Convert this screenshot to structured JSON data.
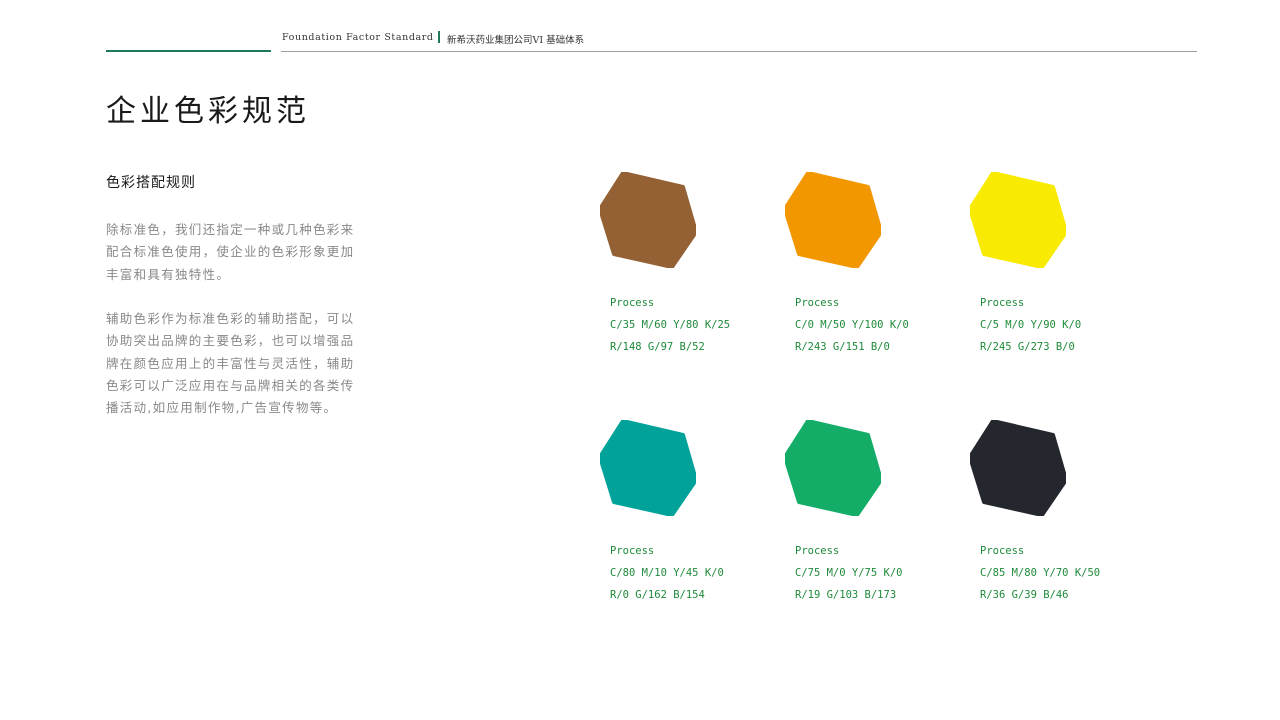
{
  "header": {
    "title_en": "Foundation Factor Standard",
    "title_cn": "新希沃药业集团公司VI 基础体系"
  },
  "page_title": "企业色彩规范",
  "section": {
    "title": "色彩搭配规则",
    "paragraph1": "除标准色，我们还指定一种或几种色彩来配合标准色使用，使企业的色彩形象更加丰富和具有独特性。",
    "paragraph2": "辅助色彩作为标准色彩的辅助搭配，可以协助突出品牌的主要色彩，也可以增强品牌在颜色应用上的丰富性与灵活性，辅助色彩可以广泛应用在与品牌相关的各类传播活动,如应用制作物,广告宣传物等。"
  },
  "swatches": [
    {
      "color": "#946134",
      "label": "Process",
      "cmyk": "C/35 M/60 Y/80 K/25",
      "rgb": "R/148 G/97 B/52"
    },
    {
      "color": "#F39700",
      "label": "Process",
      "cmyk": "C/0 M/50 Y/100 K/0",
      "rgb": "R/243 G/151 B/0"
    },
    {
      "color": "#F8EA00",
      "label": "Process",
      "cmyk": "C/5 M/0 Y/90 K/0",
      "rgb": "R/245 G/273 B/0"
    },
    {
      "color": "#00A29A",
      "label": "Process",
      "cmyk": "C/80 M/10 Y/45 K/0",
      "rgb": "R/0 G/162 B/154"
    },
    {
      "color": "#13AD67",
      "label": "Process",
      "cmyk": "C/75 M/0 Y/75 K/0",
      "rgb": "R/19 G/103 B/173"
    },
    {
      "color": "#24272E",
      "label": "Process",
      "cmyk": "C/85 M/80 Y/70 K/50",
      "rgb": "R/36 G/39 B/46"
    }
  ]
}
